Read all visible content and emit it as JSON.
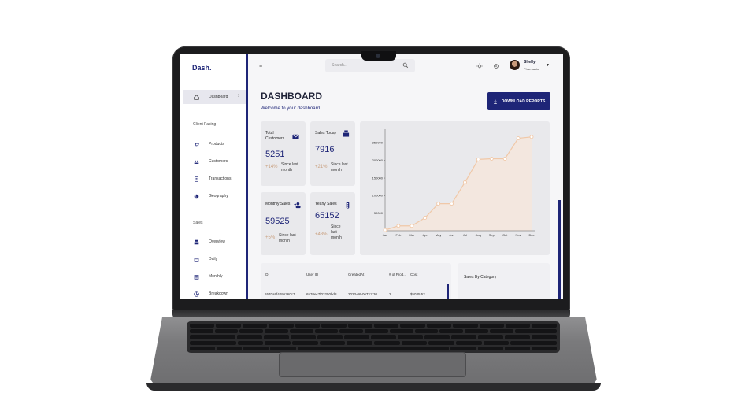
{
  "app": {
    "brand": "Dash.",
    "search_placeholder": "Search...",
    "user": {
      "name": "Shelly",
      "role": "Pharmacist"
    }
  },
  "sidebar": {
    "dashboard_label": "Dashboard",
    "sections": [
      {
        "title": "Client Facing",
        "items": [
          {
            "label": "Products",
            "icon": "cart-icon"
          },
          {
            "label": "Customers",
            "icon": "customers-icon"
          },
          {
            "label": "Transactions",
            "icon": "receipt-icon"
          },
          {
            "label": "Geography",
            "icon": "globe-icon"
          }
        ]
      },
      {
        "title": "Sales",
        "items": [
          {
            "label": "Overview",
            "icon": "overview-icon"
          },
          {
            "label": "Daily",
            "icon": "calendar-icon"
          },
          {
            "label": "Monthly",
            "icon": "calendar-month-icon"
          },
          {
            "label": "Breakdown",
            "icon": "pie-icon"
          }
        ]
      }
    ]
  },
  "page": {
    "title": "DASHBOARD",
    "subtitle": "Welcome to your dashboard",
    "download_label": "DOWNLOAD REPORTS"
  },
  "stats": [
    {
      "title": "Total Customers",
      "value": "5251",
      "change": "+14%",
      "since": "Since last month",
      "icon": "email-icon"
    },
    {
      "title": "Sales Today",
      "value": "7916",
      "change": "+21%",
      "since": "Since last month",
      "icon": "point-of-sale-icon"
    },
    {
      "title": "Monthly Sales",
      "value": "59525",
      "change": "+5%",
      "since": "Since last month",
      "icon": "person-add-icon"
    },
    {
      "title": "Yearly Sales",
      "value": "65152",
      "change": "+43%",
      "since": "Since last month",
      "icon": "traffic-icon"
    }
  ],
  "chart_data": {
    "type": "area",
    "categories": [
      "Jan",
      "Feb",
      "Mar",
      "Apr",
      "May",
      "Jun",
      "Jul",
      "Aug",
      "Sep",
      "Oct",
      "Nov",
      "Dec"
    ],
    "values": [
      2000,
      14000,
      14000,
      37000,
      77000,
      77000,
      138000,
      203000,
      205000,
      205000,
      263000,
      267000
    ],
    "y_ticks": [
      "50000",
      "100000",
      "150000",
      "200000",
      "250000"
    ],
    "ylim": [
      0,
      280000
    ],
    "colors": {
      "line": "#f0c8a8",
      "fill": "#f3e7df",
      "marker": "#f0c8a8"
    },
    "grid": false
  },
  "table": {
    "headers": [
      "ID",
      "User ID",
      "CreatedAt",
      "# of Prod...",
      "Cost"
    ],
    "row": [
      "6570a9f4095360c7...",
      "6570ec7f03250bd8...",
      "2023-06-06T12:30...",
      "2",
      "$5035.52"
    ]
  },
  "category_card": {
    "title": "Sales By Category"
  },
  "colors": {
    "primary": "#1e2577",
    "accent": "#c9a080",
    "card": "#e9e9ec"
  }
}
